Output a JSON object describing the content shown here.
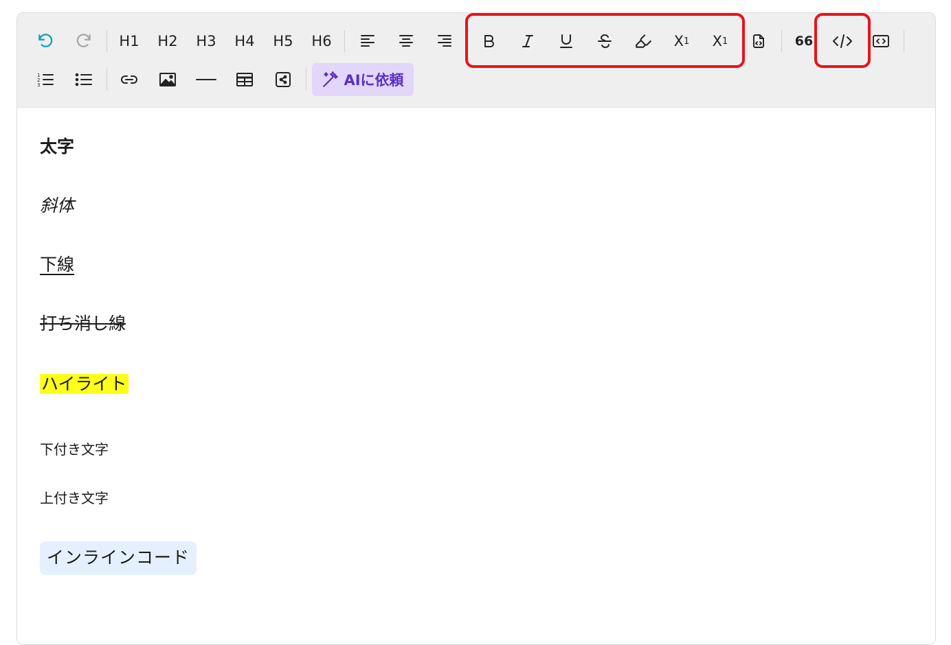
{
  "toolbar": {
    "headings": [
      "H1",
      "H2",
      "H3",
      "H4",
      "H5",
      "H6"
    ],
    "subscript_label": "X",
    "subscript_sub": "1",
    "superscript_label": "X",
    "superscript_sup": "1",
    "quote_label": "66",
    "ai_button_label": "AIに依頼",
    "highlight_color": "#e8131b",
    "ai_bg_color": "#e2d6fb",
    "ai_text_color": "#5a2fc2"
  },
  "content": {
    "bold_text": "太字",
    "italic_text": "斜体",
    "underline_text": "下線",
    "strike_text": "打ち消し線",
    "highlight_text": "ハイライト",
    "subscript_text": "下付き文字",
    "superscript_text": "上付き文字",
    "inline_code_text": "インラインコード",
    "highlight_bg_color": "#ffff1a",
    "code_bg_color": "#e4f0fd"
  }
}
